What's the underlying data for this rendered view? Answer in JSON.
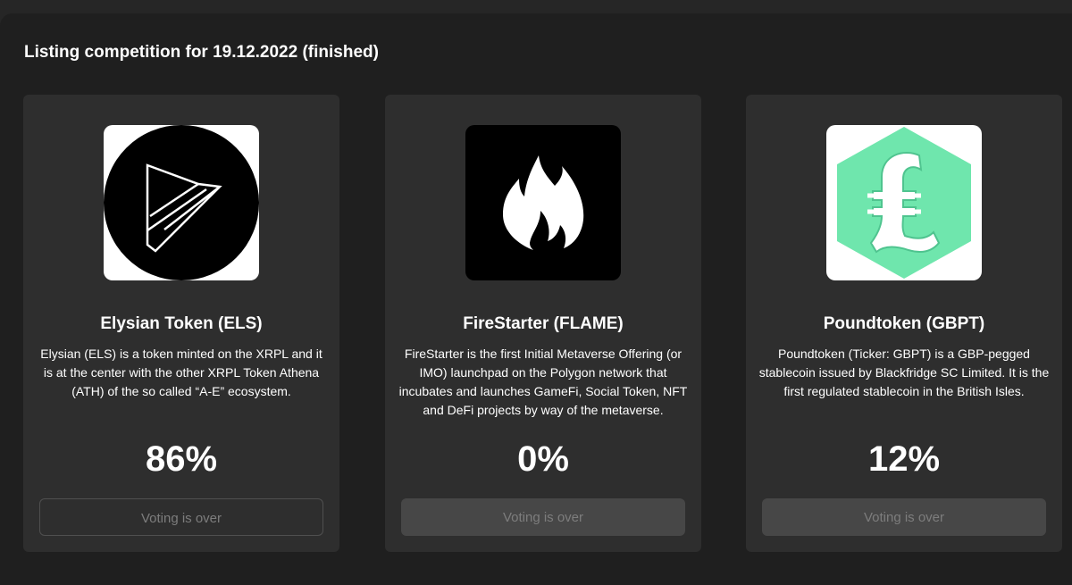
{
  "heading": "Listing competition for 19.12.2022 (finished)",
  "cards": [
    {
      "title": "Elysian Token (ELS)",
      "description": "Elysian (ELS) is a token minted on the XRPL and it is at the center with the other XRPL Token Athena (ATH) of the so called “A-E” ecosystem.",
      "percent": "86%",
      "button": "Voting is over",
      "icon": "elysian-logo-icon"
    },
    {
      "title": "FireStarter (FLAME)",
      "description": "FireStarter is the first Initial Metaverse Offering (or IMO) launchpad on the Polygon network that incubates and launches GameFi, Social Token, NFT and DeFi projects by way of the metaverse.",
      "percent": "0%",
      "button": "Voting is over",
      "icon": "flame-logo-icon"
    },
    {
      "title": "Poundtoken (GBPT)",
      "description": "Poundtoken (Ticker: GBPT) is a GBP-pegged stablecoin issued by Blackfridge SC Limited. It is the first regulated stablecoin in the British Isles.",
      "percent": "12%",
      "button": "Voting is over",
      "icon": "pound-logo-icon"
    }
  ],
  "colors": {
    "background": "#262626",
    "card": "#2e2e2e",
    "poundtoken_green": "#6fe6ad"
  }
}
